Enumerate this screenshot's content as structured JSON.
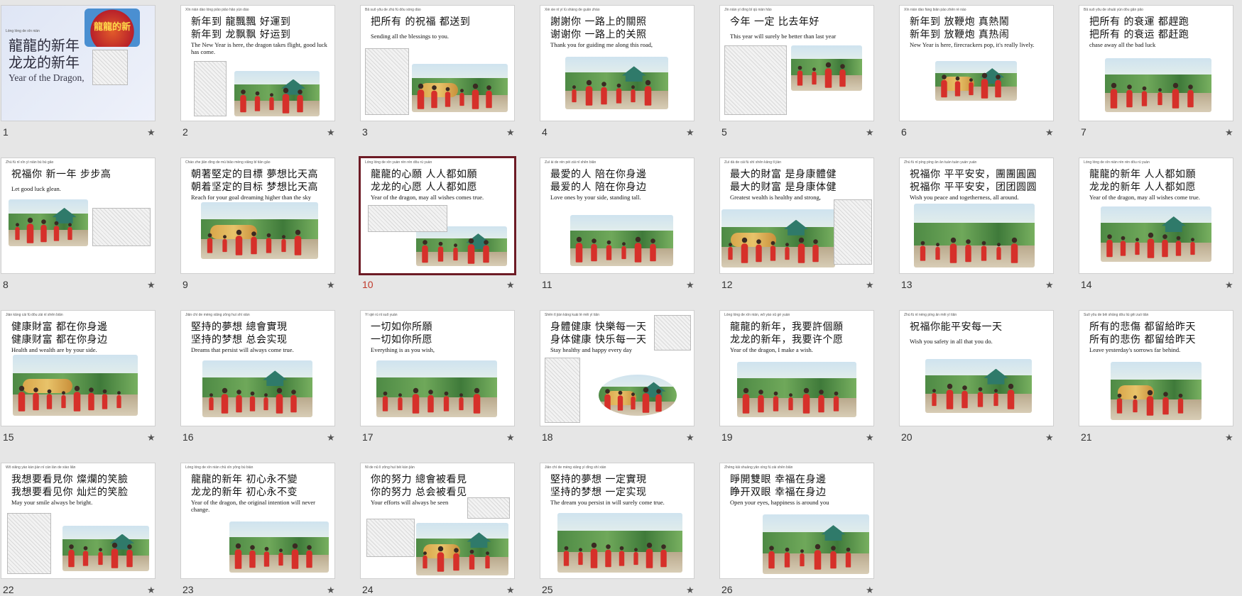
{
  "star_glyph": "★",
  "selected_slide": 10,
  "slides": [
    {
      "n": "1",
      "pinyin": "Lóng lóng de xīn nián",
      "zh1": "龍龍的新年",
      "zh2": "龙龙的新年",
      "en": "Year of the Dragon,",
      "logo": "龍龍的新"
    },
    {
      "n": "2",
      "pinyin": "Xīn nián dào  lóng piāo piāo  hǎo yùn dào",
      "zh1": "新年到 龍飄飄 好運到",
      "zh2": "新年到 龙飘飘 好运到",
      "en": "The New Year is here, the dragon takes flight, good luck has come."
    },
    {
      "n": "3",
      "pinyin": "Bǎ suǒ yǒu  de zhù fú  dōu sòng dào",
      "zh1": "把所有 的祝福 都送到",
      "zh2": "",
      "en": "Sending all the blessings to you."
    },
    {
      "n": "4",
      "pinyin": "Xiè xie nǐ  yí lù shàng de guān zhào",
      "zh1": "謝謝你 一路上的關照",
      "zh2": "谢谢你 一路上的关照",
      "en": "Thank you for guiding me along this road,"
    },
    {
      "n": "5",
      "pinyin": "Jīn nián  yí dìng  bǐ qù nián hǎo",
      "zh1": "今年 一定 比去年好",
      "zh2": "",
      "en": "This year will surely be better than last year"
    },
    {
      "n": "6",
      "pinyin": "Xīn nián dào  fàng biān pào  zhēn rè nào",
      "zh1": "新年到 放鞭炮 真熱鬧",
      "zh2": "新年到 放鞭炮 真热闹",
      "en": "New Year is here, firecrackers pop, it's really lively."
    },
    {
      "n": "7",
      "pinyin": "Bǎ suǒ yǒu  de shuāi yùn  dōu gǎn pǎo",
      "zh1": "把所有 的衰運 都趕跑",
      "zh2": "把所有 的衰运 都赶跑",
      "en": "chase away all the bad luck"
    },
    {
      "n": "8",
      "pinyin": "Zhù fú nǐ  xīn yì nián  bù bù gāo",
      "zh1": "祝福你 新一年 步步高",
      "zh2": "",
      "en": "Let good luck glean."
    },
    {
      "n": "9",
      "pinyin": "Cháo zhe jiān dìng de mù biāo  mèng xiǎng bǐ tiān gāo",
      "zh1": "朝著堅定的目標 夢想比天高",
      "zh2": "朝着坚定的目标 梦想比天高",
      "en": "Reach for your goal dreaming higher than the sky"
    },
    {
      "n": "10",
      "pinyin": "Lóng lóng de xīn yuàn  rén rén dōu rú yuàn",
      "zh1": "龍龍的心願 人人都如願",
      "zh2": "龙龙的心愿 人人都如愿",
      "en": "Year of the dragon, may all wishes comes true."
    },
    {
      "n": "11",
      "pinyin": "Zuì ài de rén  péi zài nǐ shēn biān",
      "zh1": "最愛的人 陪在你身邊",
      "zh2": "最爱的人 陪在你身边",
      "en": "Love ones by your side, standing tall."
    },
    {
      "n": "12",
      "pinyin": "Zuì dà de cái fù  shì shēn kāng tǐ jiàn",
      "zh1": "最大的財富 是身康體健",
      "zh2": "最大的财富 是身康体健",
      "en": "Greatest wealth is healthy and strong,"
    },
    {
      "n": "13",
      "pinyin": "Zhù fú nǐ  píng píng ān ān  tuán tuán yuán yuán",
      "zh1": "祝福你 平平安安，團團圓圓",
      "zh2": "祝福你 平平安安，团团圆圆",
      "en": "Wish you peace and togetherness, all around."
    },
    {
      "n": "14",
      "pinyin": "Lóng lóng de xīn nián  rén rén dōu rú yuàn",
      "zh1": "龍龍的新年 人人都如願",
      "zh2": "龙龙的新年 人人都如愿",
      "en": "Year of the dragon, may all wishes come true."
    },
    {
      "n": "15",
      "pinyin": "Jiàn kāng cái fù  dōu zài nǐ shēn biān",
      "zh1": "健康財富 都在你身邊",
      "zh2": "健康财富 都在你身边",
      "en": "Health and wealth are by your side."
    },
    {
      "n": "16",
      "pinyin": "Jiān chí de mèng xiǎng  zǒng huì shí xiàn",
      "zh1": "堅持的夢想 總會實現",
      "zh2": "坚持的梦想 总会实现",
      "en": "Dreams that persist will always come true."
    },
    {
      "n": "17",
      "pinyin": "Yí qiè rú nǐ suǒ yuàn",
      "zh1": "一切如你所願",
      "zh2": "一切如你所愿",
      "en": "Everything is as you wish,"
    },
    {
      "n": "18",
      "pinyin": "Shēn tǐ jiàn kāng  kuài lè měi yì tiān",
      "zh1": "身體健康 快樂每一天",
      "zh2": "身体健康 快乐每一天",
      "en": "Stay healthy and happy every day"
    },
    {
      "n": "19",
      "pinyin": "Lóng lóng de xīn nián,  wǒ yào xǔ gè yuàn",
      "zh1": "龍龍的新年，我要許個願",
      "zh2": "龙龙的新年，我要许个愿",
      "en": "Year of the dragon, I make a wish."
    },
    {
      "n": "20",
      "pinyin": "Zhù fú nǐ néng píng ān měi yì tiān",
      "zh1": "祝福你能平安每一天",
      "zh2": "",
      "en": "Wish you safety in all that you do."
    },
    {
      "n": "21",
      "pinyin": "Suǒ yǒu de bēi shāng  dōu liú gěi zuó tiān",
      "zh1": "所有的悲傷 都留給昨天",
      "zh2": "所有的悲伤 都留给昨天",
      "en": "Leave yesterday's sorrows far behind."
    },
    {
      "n": "22",
      "pinyin": "Wǒ xiǎng yào kàn jiàn nǐ  càn làn de xiào liǎn",
      "zh1": "我想要看見你 燦爛的笑臉",
      "zh2": "我想要看见你 灿烂的笑脸",
      "en": "May your smile always be bright."
    },
    {
      "n": "23",
      "pinyin": "Lóng lóng de xīn nián  chū xīn yǒng bú biàn",
      "zh1": "龍龍的新年 初心永不變",
      "zh2": "龙龙的新年 初心永不变",
      "en": "Year of the dragon, the original intention will never change."
    },
    {
      "n": "24",
      "pinyin": "Nǐ de nǔ lì  zǒng huì bèi kàn jiàn",
      "zh1": "你的努力 總會被看見",
      "zh2": "你的努力 总会被看见",
      "en": "Your efforts will always be seen"
    },
    {
      "n": "25",
      "pinyin": "Jiān chí de mèng xiǎng  yí dìng shí xiàn",
      "zh1": "堅持的夢想 一定實現",
      "zh2": "坚持的梦想 一定实现",
      "en": "The dream you persist in will surely come true."
    },
    {
      "n": "26",
      "pinyin": "Zhēng kāi shuāng yǎn  xìng fú zài shēn biān",
      "zh1": "睜開雙眼 幸福在身邊",
      "zh2": "睁开双眼 幸福在身边",
      "en": "Open your eyes, happiness is around you"
    }
  ]
}
